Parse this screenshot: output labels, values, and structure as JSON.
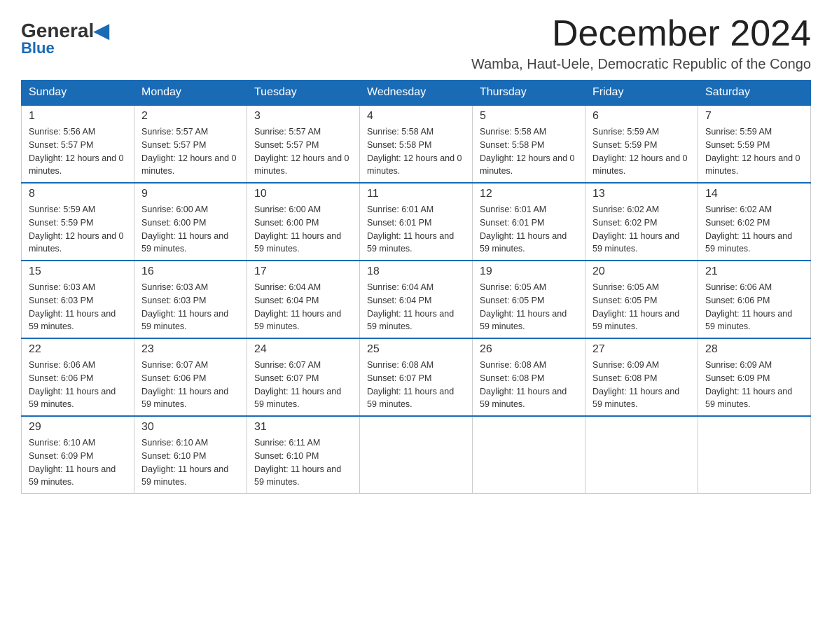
{
  "header": {
    "logo_general": "General",
    "logo_blue": "Blue",
    "month_title": "December 2024",
    "location": "Wamba, Haut-Uele, Democratic Republic of the Congo"
  },
  "weekdays": [
    "Sunday",
    "Monday",
    "Tuesday",
    "Wednesday",
    "Thursday",
    "Friday",
    "Saturday"
  ],
  "weeks": [
    [
      {
        "day": "1",
        "sunrise": "5:56 AM",
        "sunset": "5:57 PM",
        "daylight": "12 hours and 0 minutes."
      },
      {
        "day": "2",
        "sunrise": "5:57 AM",
        "sunset": "5:57 PM",
        "daylight": "12 hours and 0 minutes."
      },
      {
        "day": "3",
        "sunrise": "5:57 AM",
        "sunset": "5:57 PM",
        "daylight": "12 hours and 0 minutes."
      },
      {
        "day": "4",
        "sunrise": "5:58 AM",
        "sunset": "5:58 PM",
        "daylight": "12 hours and 0 minutes."
      },
      {
        "day": "5",
        "sunrise": "5:58 AM",
        "sunset": "5:58 PM",
        "daylight": "12 hours and 0 minutes."
      },
      {
        "day": "6",
        "sunrise": "5:59 AM",
        "sunset": "5:59 PM",
        "daylight": "12 hours and 0 minutes."
      },
      {
        "day": "7",
        "sunrise": "5:59 AM",
        "sunset": "5:59 PM",
        "daylight": "12 hours and 0 minutes."
      }
    ],
    [
      {
        "day": "8",
        "sunrise": "5:59 AM",
        "sunset": "5:59 PM",
        "daylight": "12 hours and 0 minutes."
      },
      {
        "day": "9",
        "sunrise": "6:00 AM",
        "sunset": "6:00 PM",
        "daylight": "11 hours and 59 minutes."
      },
      {
        "day": "10",
        "sunrise": "6:00 AM",
        "sunset": "6:00 PM",
        "daylight": "11 hours and 59 minutes."
      },
      {
        "day": "11",
        "sunrise": "6:01 AM",
        "sunset": "6:01 PM",
        "daylight": "11 hours and 59 minutes."
      },
      {
        "day": "12",
        "sunrise": "6:01 AM",
        "sunset": "6:01 PM",
        "daylight": "11 hours and 59 minutes."
      },
      {
        "day": "13",
        "sunrise": "6:02 AM",
        "sunset": "6:02 PM",
        "daylight": "11 hours and 59 minutes."
      },
      {
        "day": "14",
        "sunrise": "6:02 AM",
        "sunset": "6:02 PM",
        "daylight": "11 hours and 59 minutes."
      }
    ],
    [
      {
        "day": "15",
        "sunrise": "6:03 AM",
        "sunset": "6:03 PM",
        "daylight": "11 hours and 59 minutes."
      },
      {
        "day": "16",
        "sunrise": "6:03 AM",
        "sunset": "6:03 PM",
        "daylight": "11 hours and 59 minutes."
      },
      {
        "day": "17",
        "sunrise": "6:04 AM",
        "sunset": "6:04 PM",
        "daylight": "11 hours and 59 minutes."
      },
      {
        "day": "18",
        "sunrise": "6:04 AM",
        "sunset": "6:04 PM",
        "daylight": "11 hours and 59 minutes."
      },
      {
        "day": "19",
        "sunrise": "6:05 AM",
        "sunset": "6:05 PM",
        "daylight": "11 hours and 59 minutes."
      },
      {
        "day": "20",
        "sunrise": "6:05 AM",
        "sunset": "6:05 PM",
        "daylight": "11 hours and 59 minutes."
      },
      {
        "day": "21",
        "sunrise": "6:06 AM",
        "sunset": "6:06 PM",
        "daylight": "11 hours and 59 minutes."
      }
    ],
    [
      {
        "day": "22",
        "sunrise": "6:06 AM",
        "sunset": "6:06 PM",
        "daylight": "11 hours and 59 minutes."
      },
      {
        "day": "23",
        "sunrise": "6:07 AM",
        "sunset": "6:06 PM",
        "daylight": "11 hours and 59 minutes."
      },
      {
        "day": "24",
        "sunrise": "6:07 AM",
        "sunset": "6:07 PM",
        "daylight": "11 hours and 59 minutes."
      },
      {
        "day": "25",
        "sunrise": "6:08 AM",
        "sunset": "6:07 PM",
        "daylight": "11 hours and 59 minutes."
      },
      {
        "day": "26",
        "sunrise": "6:08 AM",
        "sunset": "6:08 PM",
        "daylight": "11 hours and 59 minutes."
      },
      {
        "day": "27",
        "sunrise": "6:09 AM",
        "sunset": "6:08 PM",
        "daylight": "11 hours and 59 minutes."
      },
      {
        "day": "28",
        "sunrise": "6:09 AM",
        "sunset": "6:09 PM",
        "daylight": "11 hours and 59 minutes."
      }
    ],
    [
      {
        "day": "29",
        "sunrise": "6:10 AM",
        "sunset": "6:09 PM",
        "daylight": "11 hours and 59 minutes."
      },
      {
        "day": "30",
        "sunrise": "6:10 AM",
        "sunset": "6:10 PM",
        "daylight": "11 hours and 59 minutes."
      },
      {
        "day": "31",
        "sunrise": "6:11 AM",
        "sunset": "6:10 PM",
        "daylight": "11 hours and 59 minutes."
      },
      null,
      null,
      null,
      null
    ]
  ]
}
